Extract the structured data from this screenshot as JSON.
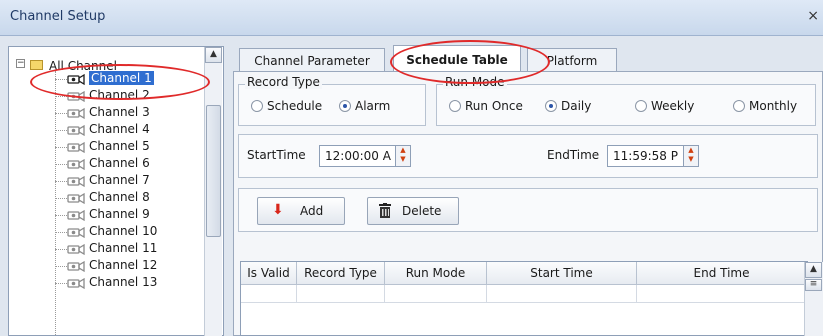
{
  "window": {
    "title": "Channel Setup",
    "close_glyph": "×"
  },
  "tree": {
    "root_label": "All Channel",
    "expander": "−",
    "items": [
      {
        "label": "Channel 1",
        "selected": true
      },
      {
        "label": "Channel 2"
      },
      {
        "label": "Channel 3"
      },
      {
        "label": "Channel 4"
      },
      {
        "label": "Channel 5"
      },
      {
        "label": "Channel 6"
      },
      {
        "label": "Channel 7"
      },
      {
        "label": "Channel 8"
      },
      {
        "label": "Channel 9"
      },
      {
        "label": "Channel 10"
      },
      {
        "label": "Channel 11"
      },
      {
        "label": "Channel 12"
      },
      {
        "label": "Channel 13"
      }
    ],
    "scroll_up": "▲"
  },
  "tabs": [
    {
      "label": "Channel Parameter"
    },
    {
      "label": "Schedule Table",
      "active": true
    },
    {
      "label": "Platform"
    }
  ],
  "record_type": {
    "legend": "Record Type",
    "options": [
      {
        "label": "Schedule",
        "checked": false
      },
      {
        "label": "Alarm",
        "checked": true
      }
    ]
  },
  "run_mode": {
    "legend": "Run Mode",
    "options": [
      {
        "label": "Run Once",
        "checked": false
      },
      {
        "label": "Daily",
        "checked": true
      },
      {
        "label": "Weekly",
        "checked": false
      },
      {
        "label": "Monthly",
        "checked": false
      }
    ]
  },
  "start_time": {
    "label": "StartTime",
    "value": "12:00:00 A"
  },
  "end_time": {
    "label": "EndTime",
    "value": "11:59:58 P"
  },
  "buttons": {
    "add": {
      "label": "Add",
      "icon": "down-arrow-icon"
    },
    "delete": {
      "label": "Delete",
      "icon": "trash-icon"
    }
  },
  "table": {
    "columns": [
      "Is Valid",
      "Record Type",
      "Run Mode",
      "Start Time",
      "End Time"
    ],
    "scroll_up": "▲"
  },
  "colors": {
    "selection": "#2f6ed0",
    "annotation": "#e02a2a",
    "add_icon": "#d8261a"
  }
}
